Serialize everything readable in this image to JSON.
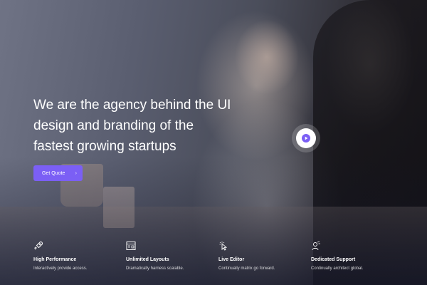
{
  "hero": {
    "headline_lines": [
      "We are the agency behind the UI",
      "design and branding of the",
      "fastest growing startups"
    ],
    "cta_label": "Get Quote",
    "cta_icon": "chevron-right-icon",
    "play_icon": "play-icon",
    "accent_color": "#7b5ff5"
  },
  "features": [
    {
      "icon": "rocket-icon",
      "title": "High Performance",
      "desc": "Interactively provide access."
    },
    {
      "icon": "layout-icon",
      "title": "Unlimited Layouts",
      "desc": "Dramatically harness scalable."
    },
    {
      "icon": "cursor-click-icon",
      "title": "Live Editor",
      "desc": "Continually matrix go forward."
    },
    {
      "icon": "support-agent-icon",
      "title": "Dedicated Support",
      "desc": "Continually architect global."
    }
  ]
}
